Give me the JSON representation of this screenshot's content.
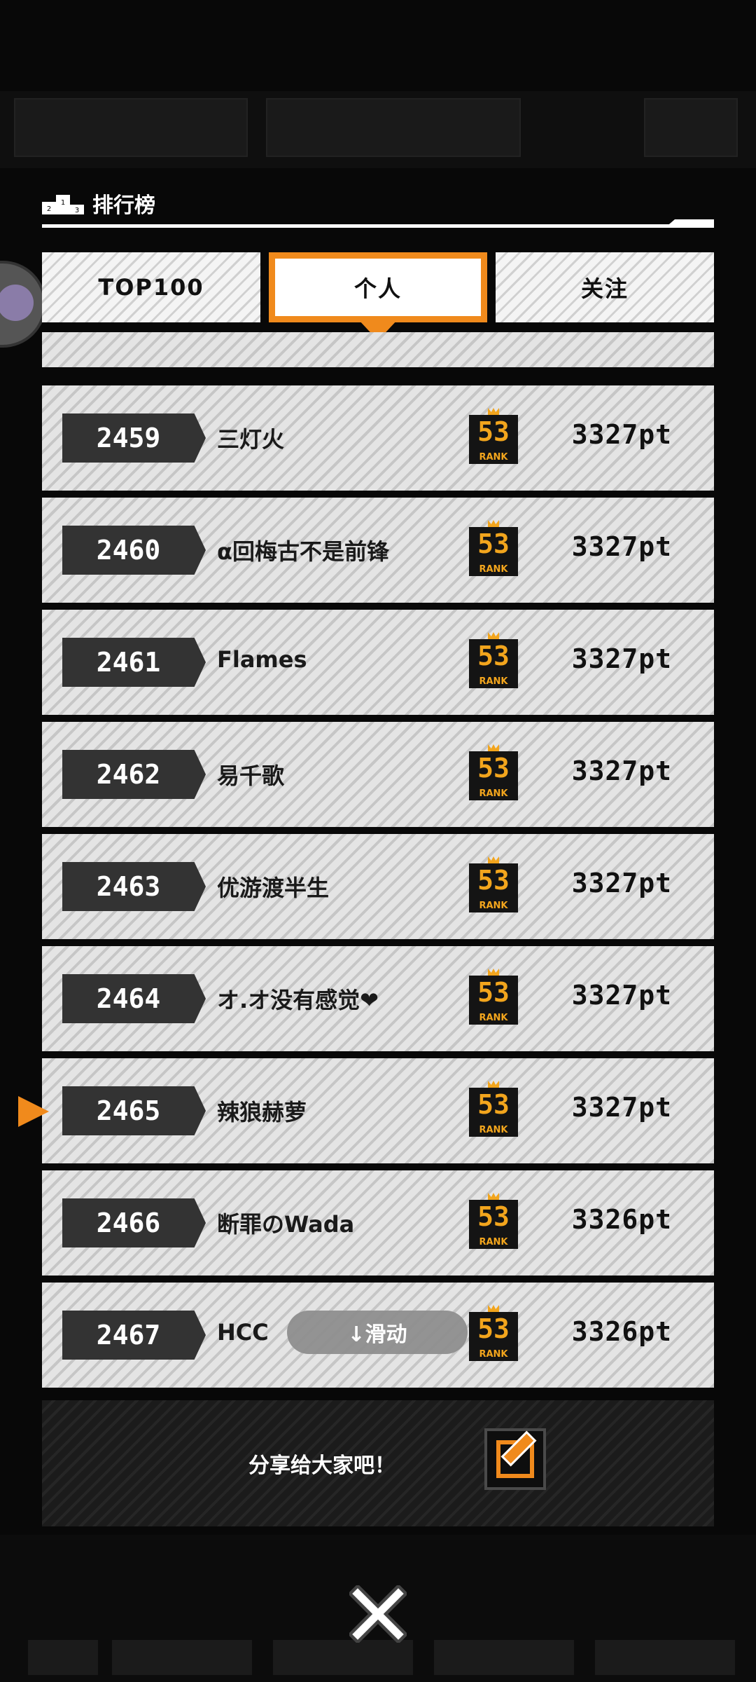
{
  "header": {
    "title": "排行榜"
  },
  "tabs": [
    {
      "label": "TOP100",
      "active": false
    },
    {
      "label": "个人",
      "active": true
    },
    {
      "label": "关注",
      "active": false
    }
  ],
  "colors": {
    "accent": "#f08a1c",
    "badge": "#f2a51d"
  },
  "rows": [
    {
      "rank": "2459",
      "name": "三灯火",
      "badge": "53",
      "badge_label": "RANK",
      "points": "3327pt"
    },
    {
      "rank": "2460",
      "name": "α回梅古不是前锋",
      "badge": "53",
      "badge_label": "RANK",
      "points": "3327pt"
    },
    {
      "rank": "2461",
      "name": "Flames",
      "badge": "53",
      "badge_label": "RANK",
      "points": "3327pt"
    },
    {
      "rank": "2462",
      "name": "易千歌",
      "badge": "53",
      "badge_label": "RANK",
      "points": "3327pt"
    },
    {
      "rank": "2463",
      "name": "优游渡半生",
      "badge": "53",
      "badge_label": "RANK",
      "points": "3327pt"
    },
    {
      "rank": "2464",
      "name": "オ.オ没有感觉❤",
      "badge": "53",
      "badge_label": "RANK",
      "points": "3327pt"
    },
    {
      "rank": "2465",
      "name": "辣狼赫萝",
      "badge": "53",
      "badge_label": "RANK",
      "points": "3327pt",
      "current": true
    },
    {
      "rank": "2466",
      "name": "断罪のWada",
      "badge": "53",
      "badge_label": "RANK",
      "points": "3326pt"
    },
    {
      "rank": "2467",
      "name": "HCC",
      "badge": "53",
      "badge_label": "RANK",
      "points": "3326pt"
    }
  ],
  "scroll_hint": "↓滑动",
  "share": {
    "label": "分享给大家吧！"
  },
  "icons": {
    "close": "close-icon",
    "share": "edit-share-icon",
    "podium": "podium-icon",
    "pointer": "current-row-arrow-icon"
  }
}
